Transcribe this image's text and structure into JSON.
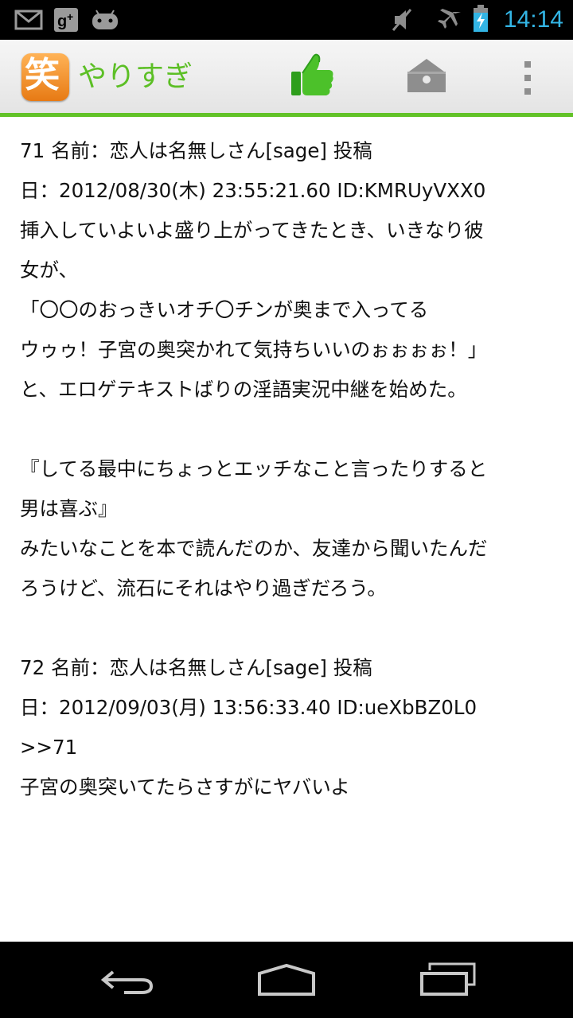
{
  "status_bar": {
    "clock": "14:14",
    "left_icons": [
      "gmail-icon",
      "google-plus-icon",
      "android-icon"
    ],
    "right_icons": [
      "volume-muted-icon",
      "airplane-mode-icon",
      "battery-charging-icon"
    ],
    "clock_color": "#33b5e5"
  },
  "action_bar": {
    "app_icon_glyph": "笑",
    "title": "やりすぎ",
    "accent_color": "#5cbf25",
    "actions": [
      "thumbs-up-icon",
      "inbox-tray-icon",
      "overflow-menu-icon"
    ]
  },
  "posts": [
    {
      "header_line1": "71 名前：恋人は名無しさん[sage] 投稿",
      "header_line2": "日：2012/08/30(木) 23:55:21.60 ID:KMRUyVXX0",
      "body_lines": [
        "挿入していよいよ盛り上がってきたとき、いきなり彼",
        "女が、",
        "「〇〇のおっきいオチ〇チンが奥まで入ってる",
        "ウゥゥ！子宮の奥突かれて気持ちいいのぉぉぉぉ！」",
        "と、エロゲテキストばりの淫語実況中継を始めた。",
        "",
        "『してる最中にちょっとエッチなこと言ったりすると",
        "男は喜ぶ』",
        "みたいなことを本で読んだのか、友達から聞いたんだ",
        "ろうけど、流石にそれはやり過ぎだろう。"
      ]
    },
    {
      "header_line1": "72 名前：恋人は名無しさん[sage] 投稿",
      "header_line2": "日：2012/09/03(月) 13:56:33.40 ID:ueXbBZ0L0",
      "body_lines": [
        ">>71",
        "子宮の奥突いてたらさすがにヤバいよ"
      ]
    }
  ],
  "nav_bar": {
    "buttons": [
      "back-icon",
      "home-icon",
      "recent-apps-icon"
    ]
  }
}
